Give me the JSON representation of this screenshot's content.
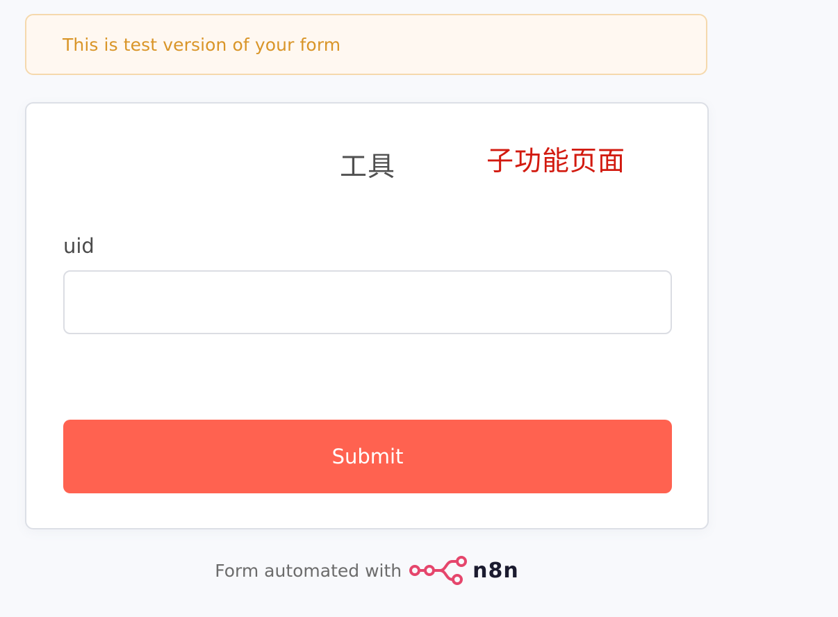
{
  "banner": {
    "text": "This is test version of your form"
  },
  "form": {
    "title": "工具",
    "annotation": "子功能页面",
    "fields": [
      {
        "label": "uid",
        "value": "",
        "placeholder": ""
      }
    ],
    "submit_label": "Submit"
  },
  "footer": {
    "text": "Form automated with",
    "logo_icon": "n8n-logo-icon",
    "brand": "n8n"
  },
  "colors": {
    "background": "#f8f9fc",
    "banner_bg": "#fff8f1",
    "banner_text": "#d99528",
    "banner_border": "#f5d9ad",
    "submit_button": "#ff6250",
    "annotation_red": "#d21a0f",
    "n8n_pink": "#e5466c"
  }
}
